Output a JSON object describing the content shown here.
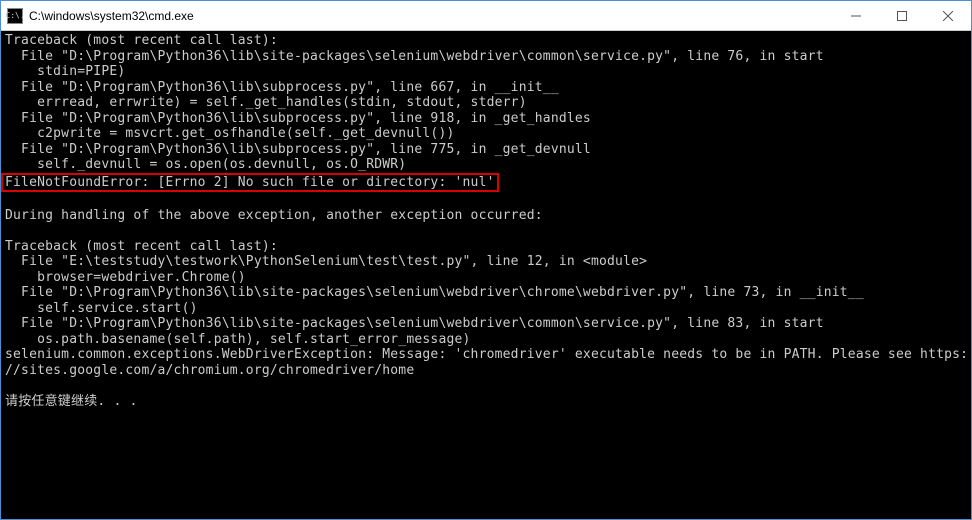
{
  "titlebar": {
    "icon_label": "C:\\.",
    "title": "C:\\windows\\system32\\cmd.exe"
  },
  "window_controls": {
    "min": "–",
    "max": "☐",
    "close": "✕"
  },
  "terminal": {
    "l1": "Traceback (most recent call last):",
    "l2": "  File \"D:\\Program\\Python36\\lib\\site-packages\\selenium\\webdriver\\common\\service.py\", line 76, in start",
    "l3": "    stdin=PIPE)",
    "l4": "  File \"D:\\Program\\Python36\\lib\\subprocess.py\", line 667, in __init__",
    "l5": "    errread, errwrite) = self._get_handles(stdin, stdout, stderr)",
    "l6": "  File \"D:\\Program\\Python36\\lib\\subprocess.py\", line 918, in _get_handles",
    "l7": "    c2pwrite = msvcrt.get_osfhandle(self._get_devnull())",
    "l8": "  File \"D:\\Program\\Python36\\lib\\subprocess.py\", line 775, in _get_devnull",
    "l9": "    self._devnull = os.open(os.devnull, os.O_RDWR)",
    "l10": "FileNotFoundError: [Errno 2] No such file or directory: 'nul'",
    "l11": "",
    "l12": "During handling of the above exception, another exception occurred:",
    "l13": "",
    "l14": "Traceback (most recent call last):",
    "l15": "  File \"E:\\teststudy\\testwork\\PythonSelenium\\test\\test.py\", line 12, in <module>",
    "l16": "    browser=webdriver.Chrome()",
    "l17": "  File \"D:\\Program\\Python36\\lib\\site-packages\\selenium\\webdriver\\chrome\\webdriver.py\", line 73, in __init__",
    "l18": "    self.service.start()",
    "l19": "  File \"D:\\Program\\Python36\\lib\\site-packages\\selenium\\webdriver\\common\\service.py\", line 83, in start",
    "l20": "    os.path.basename(self.path), self.start_error_message)",
    "l21": "selenium.common.exceptions.WebDriverException: Message: 'chromedriver' executable needs to be in PATH. Please see https:",
    "l22": "//sites.google.com/a/chromium.org/chromedriver/home",
    "l23": "",
    "l24": "请按任意键继续. . ."
  }
}
